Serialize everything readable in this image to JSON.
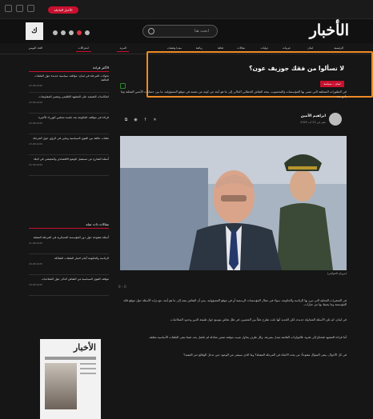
{
  "ticker": {
    "badge": "الأخبار العاجلة"
  },
  "header": {
    "brand": "الأخبار",
    "logo_letter": "ﻙ",
    "search_placeholder": "ابحث هنا"
  },
  "nav": {
    "items": [
      "الرئيسية",
      "لبنان",
      "عربيات",
      "دوليات",
      "مقالات",
      "ثقافة",
      "رياضة",
      "ميديا وتقنيات",
      "المزيد",
      "اشتراكات",
      "العدد اليومي"
    ]
  },
  "article": {
    "title": "لا تسألوا من فقك جوزيف عون؟",
    "tag": "لبنان – سياسة",
    "lead": "في التطورات المتعلقة التي تسير بها المؤسسات والمحسوب، يتجه النقاش الخطابي الحالي إلى ما هو أبعد من كونه من نفسه في موقع المسؤولية، ما بين حسابات الأمس المعلنة وما يأتي بعد",
    "author": "ابراهيم الأمين",
    "date": "نشر في 23 آب 2025",
    "caption": "(مروان الحولاني)",
    "counter": "0 – 0",
    "paragraphs": [
      "في المتغيرات المحلية التي تبرز بها الرئاسة والحكومة، سواء في مجال المؤسسات الرسمية أو في موقع المسؤولية، يبدو أن النقاش يتجه إلى ما هو أبعد، مع تزايد الأسئلة حول موقع قائد المؤسسة وما يحيط بها من خيارات.",
      "في لبنان، لم تكن الأسئلة المتداولة جديدة، لكن الجديد أنها باتت تطرح علناً بين المعنيين، في ظل نقاش يتوسع حول طبيعة الدور وحدود الصلاحيات.",
      "أما قراءة المشهد فتحتاج إلى هدوء، فالتوازنات القائمة تتبدل بسرعة، وكل طرف يحاول تثبيت موقعه ضمن معادلة لم تكتمل بعد، فيما تبقى الملفات الأساسية معلقة.",
      "في كل الأحوال، يبقى السؤال مفتوحاً: من يحدد الاتجاه في المرحلة المقبلة؟ وما الذي سيبقى من الوعود حين تدخل الوقائع حيز التنفيذ؟"
    ]
  },
  "sidebar": {
    "latest_head": "الأكثر قراءة",
    "latest": [
      {
        "title": "تحولات المرحلة في لبنان: مواقف سياسية جديدة حول الملفات العالقة",
        "date": "23.08.2025"
      },
      {
        "title": "انعكاسات التصعيد على المشهد الإقليمي ومصير المفاوضات",
        "date": "23.08.2025"
      },
      {
        "title": "قراءة في مواقف الحكومة بعد جلسة مجلس الوزراء الأخيرة",
        "date": "23.08.2025"
      },
      {
        "title": "ملفات عالقة بين القوى السياسية وتباين في الرؤى حول المرحلة",
        "date": "23.08.2025"
      },
      {
        "title": "أسئلة الشارع عن مستقبل الوضع الاقتصادي والمعيشي في البلاد",
        "date": "22.08.2025"
      }
    ],
    "related_head": "مقالات ذات صلة",
    "related": [
      {
        "title": "أسئلة مفتوحة حول دور المؤسسة العسكرية في المرحلة المقبلة",
        "date": "21.08.2025"
      },
      {
        "title": "الرئاسة والحكومة أمام اختبار الملفات الشائكة",
        "date": "20.08.2025"
      },
      {
        "title": "موقف القوى السياسية من النقاش الدائر حول الصلاحيات",
        "date": "19.08.2025"
      }
    ],
    "paper_brand": "الأخبار"
  },
  "colors": {
    "accent": "#c8102e",
    "highlight": "#f08a24",
    "bg": "#161616"
  }
}
